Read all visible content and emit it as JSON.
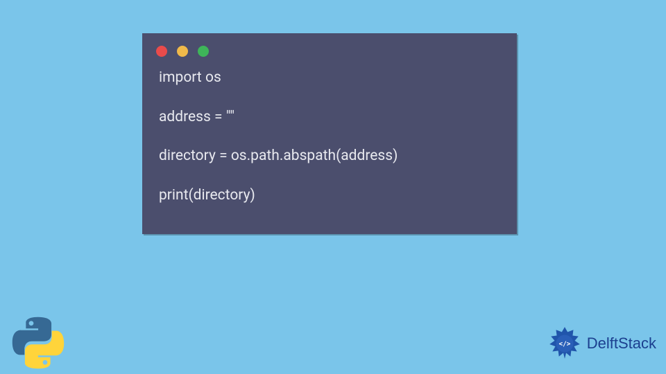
{
  "code_window": {
    "traffic_lights": {
      "red": "#e94b4b",
      "yellow": "#f0b94a",
      "green": "#3eb559"
    },
    "code": "import os\n\naddress = \"\"\n\ndirectory = os.path.abspath(address)\n\nprint(directory)"
  },
  "brand": {
    "name": "DelftStack"
  },
  "colors": {
    "page_bg": "#7ac5ea",
    "window_bg": "#4b4e6d",
    "code_text": "#e8e9ef",
    "brand_text": "#1b3f8f",
    "python_blue": "#366994",
    "python_yellow": "#ffd43b"
  }
}
